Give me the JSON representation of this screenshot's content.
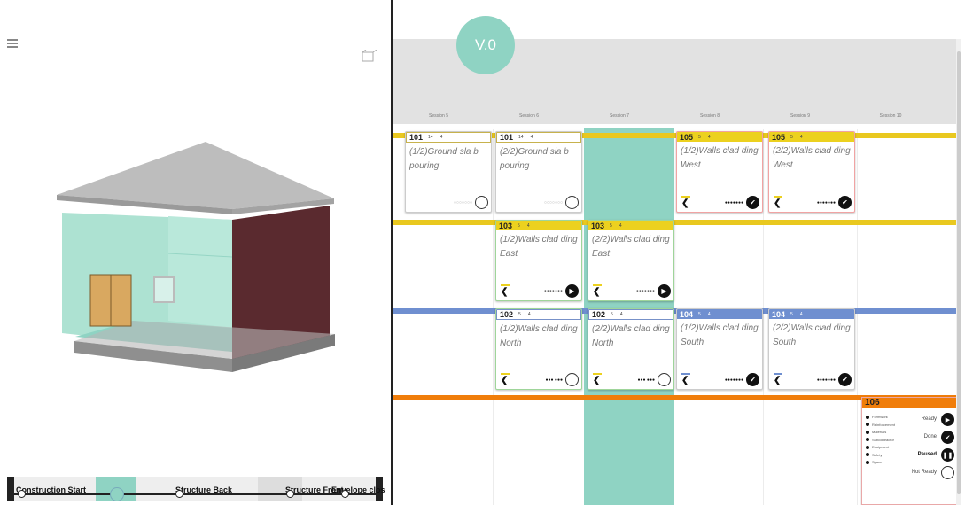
{
  "version_badge": "V.0",
  "viewer": {
    "timeline": {
      "labels": [
        "Construction Start",
        "Structure Back",
        "Structure Front",
        "Envelope clos"
      ]
    }
  },
  "board": {
    "sessions": [
      "Session 5",
      "Session 6",
      "Session 7",
      "Session 8",
      "Session 9",
      "Session 10"
    ],
    "cards": [
      {
        "id": "101",
        "meta_a": "14",
        "meta_b": "4",
        "title": "(1/2)Ground sla b pouring",
        "status": "empty"
      },
      {
        "id": "101",
        "meta_a": "14",
        "meta_b": "4",
        "title": "(2/2)Ground sla b pouring",
        "status": "empty"
      },
      {
        "id": "105",
        "meta_a": "5",
        "meta_b": "4",
        "title": "(1/2)Walls clad ding West",
        "status": "done"
      },
      {
        "id": "105",
        "meta_a": "5",
        "meta_b": "4",
        "title": "(2/2)Walls clad ding West",
        "status": "done"
      },
      {
        "id": "103",
        "meta_a": "5",
        "meta_b": "4",
        "title": "(1/2)Walls clad ding East",
        "status": "ready"
      },
      {
        "id": "103",
        "meta_a": "5",
        "meta_b": "4",
        "title": "(2/2)Walls clad ding East",
        "status": "ready"
      },
      {
        "id": "102",
        "meta_a": "5",
        "meta_b": "4",
        "title": "(1/2)Walls clad ding North",
        "status": "empty"
      },
      {
        "id": "102",
        "meta_a": "5",
        "meta_b": "4",
        "title": "(2/2)Walls clad ding North",
        "status": "empty"
      },
      {
        "id": "104",
        "meta_a": "5",
        "meta_b": "4",
        "title": "(1/2)Walls clad ding South",
        "status": "done"
      },
      {
        "id": "104",
        "meta_a": "5",
        "meta_b": "4",
        "title": "(2/2)Walls clad ding South",
        "status": "done"
      }
    ],
    "legend": {
      "id": "106",
      "items": [
        "Formwork",
        "Reinforcement",
        "Materials",
        "Subcontractor",
        "Equipment",
        "Safety",
        "Space"
      ],
      "statuses": [
        {
          "label": "Ready",
          "icon": "ready-icon"
        },
        {
          "label": "Done",
          "icon": "check-icon"
        },
        {
          "label": "Paused",
          "icon": "pause-icon"
        },
        {
          "label": "Not Ready",
          "icon": "empty-circle-icon"
        }
      ]
    }
  },
  "colors": {
    "teal": "#8fd3c3",
    "yellow_lane": "#e9c81f",
    "blue_lane": "#6f8fd0",
    "orange_lane": "#f07d0a",
    "wall_dark": "#5a2a2f"
  }
}
